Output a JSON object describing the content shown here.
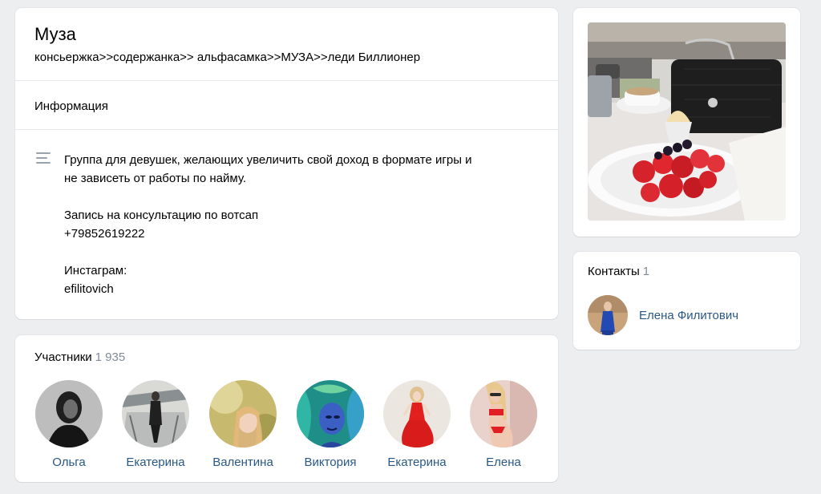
{
  "group": {
    "name": "Муза",
    "status": "консьержка>>содержанка>> альфасамка>>МУЗА>>леди Биллионер"
  },
  "info": {
    "title": "Информация",
    "icon": "description-icon",
    "lines": [
      "Группа для девушек, желающих увеличить свой доход в формате игры и",
      "не зависеть от работы по найму.",
      "",
      "Запись на консультацию по вотсап",
      "+79852619222",
      "",
      "Инстаграм:",
      "efilitovich"
    ]
  },
  "members": {
    "title": "Участники",
    "count": "1 935",
    "list": [
      {
        "name": "Ольга"
      },
      {
        "name": "Екатерина"
      },
      {
        "name": "Валентина"
      },
      {
        "name": "Виктория"
      },
      {
        "name": "Екатерина"
      },
      {
        "name": "Елена"
      }
    ]
  },
  "contacts": {
    "title": "Контакты",
    "count": "1",
    "list": [
      {
        "name": "Елена Филитович"
      }
    ]
  },
  "colors": {
    "background": "#edeef0",
    "link": "#2a5885",
    "muted": "#818c99"
  }
}
